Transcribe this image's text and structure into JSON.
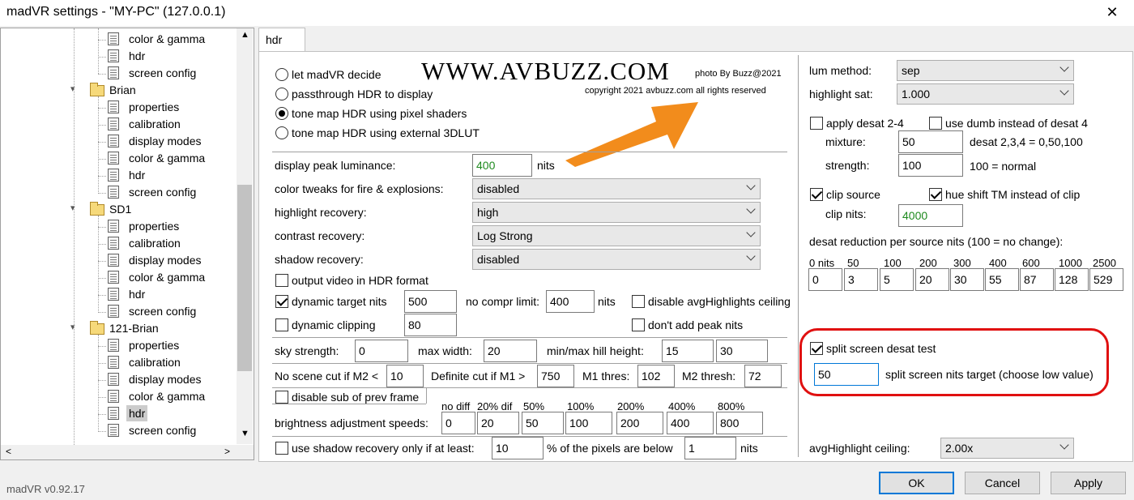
{
  "window": {
    "title": "madVR settings - \"MY-PC\" (127.0.0.1)",
    "close": "✕",
    "version": "madVR v0.92.17"
  },
  "tree": {
    "items": [
      {
        "label": "color & gamma"
      },
      {
        "label": "hdr"
      },
      {
        "label": "screen config"
      },
      {
        "label": "Brian"
      },
      {
        "label": "properties"
      },
      {
        "label": "calibration"
      },
      {
        "label": "display modes"
      },
      {
        "label": "color & gamma"
      },
      {
        "label": "hdr"
      },
      {
        "label": "screen config"
      },
      {
        "label": "SD1"
      },
      {
        "label": "properties"
      },
      {
        "label": "calibration"
      },
      {
        "label": "display modes"
      },
      {
        "label": "color & gamma"
      },
      {
        "label": "hdr"
      },
      {
        "label": "screen config"
      },
      {
        "label": "121-Brian"
      },
      {
        "label": "properties"
      },
      {
        "label": "calibration"
      },
      {
        "label": "display modes"
      },
      {
        "label": "color & gamma"
      },
      {
        "label": "hdr"
      },
      {
        "label": "screen config"
      }
    ]
  },
  "tab": {
    "label": "hdr"
  },
  "watermark": {
    "site": "WWW.AVBUZZ.COM",
    "photo_by": "photo By Buzz@2021",
    "copyright": "copyright 2021 avbuzz.com all rights reserved"
  },
  "hdr_mode": {
    "options": [
      "let madVR decide",
      "passthrough HDR to display",
      "tone map HDR using pixel shaders",
      "tone map HDR using external 3DLUT"
    ],
    "selected": "tone map HDR using pixel shaders"
  },
  "left": {
    "display_peak_label": "display peak luminance:",
    "display_peak_value": "400",
    "nits": "nits",
    "color_tweaks_label": "color tweaks for fire & explosions:",
    "color_tweaks_value": "disabled",
    "highlight_recovery_label": "highlight recovery:",
    "highlight_recovery_value": "high",
    "contrast_recovery_label": "contrast recovery:",
    "contrast_recovery_value": "Log Strong",
    "shadow_recovery_label": "shadow recovery:",
    "shadow_recovery_value": "disabled",
    "output_hdr_label": "output video in HDR format",
    "output_hdr_checked": false,
    "dynamic_target_label": "dynamic target nits",
    "dynamic_target_checked": true,
    "dynamic_target_value": "500",
    "no_compr_label": "no compr limit:",
    "no_compr_value": "400",
    "no_compr_unit": "nits",
    "disable_avg_label": "disable avgHighlights ceiling",
    "disable_avg_checked": false,
    "dynamic_clipping_label": "dynamic clipping",
    "dynamic_clipping_checked": false,
    "dynamic_clipping_value": "80",
    "dont_add_peak_label": "don't add peak nits",
    "dont_add_peak_checked": false,
    "sky_strength_label": "sky strength:",
    "sky_strength_value": "0",
    "max_width_label": "max width:",
    "max_width_value": "20",
    "minmax_hill_label": "min/max hill height:",
    "min_hill_value": "15",
    "max_hill_value": "30",
    "no_scene_cut_label": "No scene cut if M2 <",
    "no_scene_cut_value": "10",
    "definite_cut_label": "Definite cut if M1 >",
    "definite_cut_value": "750",
    "m1_thres_label": "M1 thres:",
    "m1_thres_value": "102",
    "m2_thresh_label": "M2 thresh:",
    "m2_thresh_value": "72",
    "disable_sub_label": "disable sub of prev frame",
    "disable_sub_checked": false,
    "speed_headers": [
      "no diff",
      "20% dif",
      "50%",
      "100%",
      "200%",
      "400%",
      "800%"
    ],
    "brightness_speeds_label": "brightness adjustment speeds:",
    "brightness_speeds": [
      "0",
      "20",
      "50",
      "100",
      "200",
      "400",
      "800"
    ],
    "shadow_only_label": "use shadow recovery only if at least:",
    "shadow_only_checked": false,
    "shadow_only_value": "10",
    "pixels_below_label": "% of the pixels are below",
    "pixels_below_value": "1",
    "pixels_below_unit": "nits"
  },
  "right": {
    "lum_method_label": "lum method:",
    "lum_method_value": "sep",
    "highlight_sat_label": "highlight sat:",
    "highlight_sat_value": "1.000",
    "apply_desat_label": "apply desat 2-4",
    "apply_desat_checked": false,
    "use_dumb_label": "use dumb instead of desat 4",
    "use_dumb_checked": false,
    "mixture_label": "mixture:",
    "mixture_value": "50",
    "mixture_note": "desat 2,3,4 = 0,50,100",
    "strength_label": "strength:",
    "strength_value": "100",
    "strength_note": "100 = normal",
    "clip_source_label": "clip source",
    "clip_source_checked": true,
    "hue_shift_label": "hue shift TM instead of clip",
    "hue_shift_checked": true,
    "clip_nits_label": "clip nits:",
    "clip_nits_value": "4000",
    "desat_reduction_label": "desat reduction per source nits (100 = no change):",
    "desat_headers": [
      "0 nits",
      "50",
      "100",
      "200",
      "300",
      "400",
      "600",
      "1000",
      "2500"
    ],
    "desat_values": [
      "0",
      "3",
      "5",
      "20",
      "30",
      "55",
      "87",
      "128",
      "529"
    ],
    "split_test_label": "split screen desat test",
    "split_test_checked": true,
    "split_target_value": "50",
    "split_target_label": "split screen nits target (choose low value)",
    "avg_ceiling_label": "avgHighlight ceiling:",
    "avg_ceiling_value": "2.00x"
  },
  "buttons": {
    "ok": "OK",
    "cancel": "Cancel",
    "apply": "Apply"
  }
}
